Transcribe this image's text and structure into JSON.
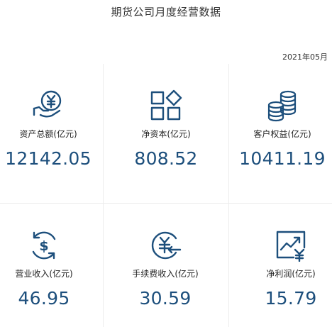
{
  "title": "期货公司月度经营数据",
  "date": "2021年05月",
  "metrics": [
    {
      "icon": "yen-coin-hand-icon",
      "label": "资产总额(亿元)",
      "value": "12142.05"
    },
    {
      "icon": "grid-diamond-icon",
      "label": "净资本(亿元)",
      "value": "808.52"
    },
    {
      "icon": "coin-stack-icon",
      "label": "客户权益(亿元)",
      "value": "10411.19"
    },
    {
      "icon": "dollar-cycle-icon",
      "label": "营业收入(亿元)",
      "value": "46.95"
    },
    {
      "icon": "yen-arrow-icon",
      "label": "手续费收入(亿元)",
      "value": "30.59"
    },
    {
      "icon": "trend-chart-yen-icon",
      "label": "净利润(亿元)",
      "value": "15.79"
    }
  ],
  "colors": {
    "value": "#1d4f7c",
    "icon": "#1d4f7c",
    "divider": "#ececec"
  }
}
